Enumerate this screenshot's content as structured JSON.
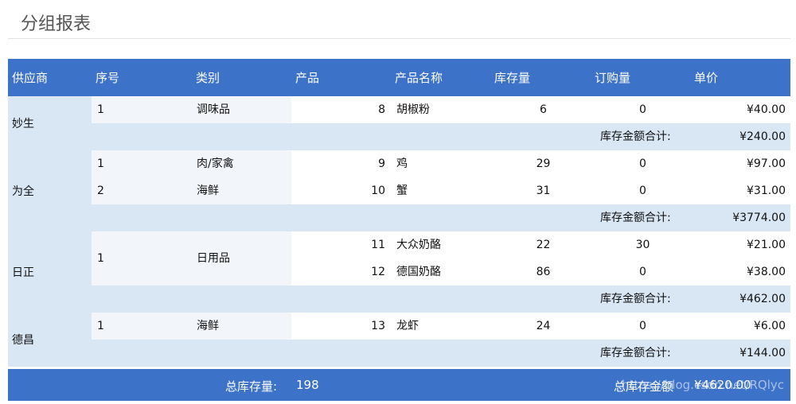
{
  "page": {
    "title": "分组报表"
  },
  "headers": [
    "供应商",
    "序号",
    "类别",
    "产品",
    "产品名称",
    "库存量",
    "订购量",
    "单价"
  ],
  "subtotal_label": "库存金额合计:",
  "groups": [
    {
      "supplier": "妙生",
      "categories": [
        {
          "seq": "1",
          "category": "调味品",
          "products": [
            {
              "id": "8",
              "name": "胡椒粉",
              "stock": "6",
              "order": "0",
              "price": "¥40.00"
            }
          ]
        }
      ],
      "subtotal": "¥240.00"
    },
    {
      "supplier": "为全",
      "categories": [
        {
          "seq": "1",
          "category": "肉/家禽",
          "products": [
            {
              "id": "9",
              "name": "鸡",
              "stock": "29",
              "order": "0",
              "price": "¥97.00"
            }
          ]
        },
        {
          "seq": "2",
          "category": "海鲜",
          "products": [
            {
              "id": "10",
              "name": "蟹",
              "stock": "31",
              "order": "0",
              "price": "¥31.00"
            }
          ]
        }
      ],
      "subtotal": "¥3774.00"
    },
    {
      "supplier": "日正",
      "categories": [
        {
          "seq": "1",
          "category": "日用品",
          "products": [
            {
              "id": "11",
              "name": "大众奶酪",
              "stock": "22",
              "order": "30",
              "price": "¥21.00"
            },
            {
              "id": "12",
              "name": "德国奶酪",
              "stock": "86",
              "order": "0",
              "price": "¥38.00"
            }
          ]
        }
      ],
      "subtotal": "¥462.00"
    },
    {
      "supplier": "德昌",
      "categories": [
        {
          "seq": "1",
          "category": "海鲜",
          "products": [
            {
              "id": "13",
              "name": "龙虾",
              "stock": "24",
              "order": "0",
              "price": "¥6.00"
            }
          ]
        }
      ],
      "subtotal": "¥144.00"
    }
  ],
  "footer": {
    "stock_label": "总库存量:",
    "stock_value": "198",
    "amount_label": "总库存金额",
    "amount_value": "¥4620.00"
  },
  "watermark": "https://blog.csdn.net/RQlyc"
}
